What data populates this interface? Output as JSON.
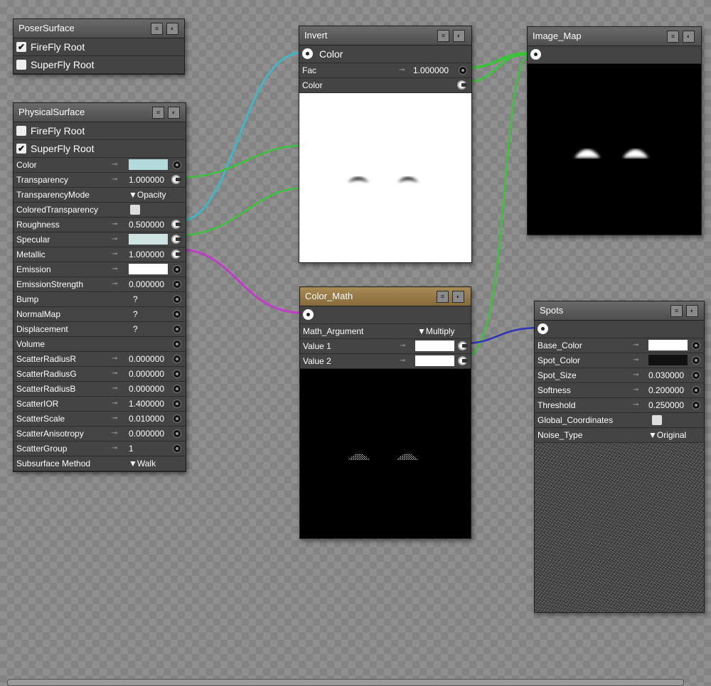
{
  "colors": {
    "wire_cyan": "#3fb7c7",
    "wire_green": "#3cc33c",
    "wire_magenta": "#c23ac9",
    "wire_blue": "#2d33b8",
    "gold_header": "#a88a55"
  },
  "poser_surface": {
    "title": "PoserSurface",
    "rows": [
      {
        "label": "FireFly Root",
        "checked": true
      },
      {
        "label": "SuperFly Root",
        "checked": false
      }
    ]
  },
  "physical_surface": {
    "title": "PhysicalSurface",
    "firefly": "FireFly Root",
    "superfly": "SuperFly Root",
    "params": [
      {
        "label": "Color"
      },
      {
        "label": "Transparency",
        "value": "1.000000"
      },
      {
        "label": "TransparencyMode",
        "value": "▼Opacity"
      },
      {
        "label": "ColoredTransparency"
      },
      {
        "label": "Roughness",
        "value": "0.500000"
      },
      {
        "label": "Specular"
      },
      {
        "label": "Metallic",
        "value": "1.000000"
      },
      {
        "label": "Emission"
      },
      {
        "label": "EmissionStrength",
        "value": "0.000000"
      },
      {
        "label": "Bump",
        "value": "?"
      },
      {
        "label": "NormalMap",
        "value": "?"
      },
      {
        "label": "Displacement",
        "value": "?"
      },
      {
        "label": "Volume"
      },
      {
        "label": "ScatterRadiusR",
        "value": "0.000000"
      },
      {
        "label": "ScatterRadiusG",
        "value": "0.000000"
      },
      {
        "label": "ScatterRadiusB",
        "value": "0.000000"
      },
      {
        "label": "ScatterIOR",
        "value": "1.400000"
      },
      {
        "label": "ScatterScale",
        "value": "0.010000"
      },
      {
        "label": "ScatterAnisotropy",
        "value": "0.000000"
      },
      {
        "label": "ScatterGroup",
        "value": "1"
      },
      {
        "label": "Subsurface Method",
        "value": "▼Walk"
      }
    ]
  },
  "invert": {
    "title": "Invert",
    "out_label": "Color",
    "fac_label": "Fac",
    "fac_value": "1.000000",
    "color_label": "Color"
  },
  "image_map": {
    "title": "Image_Map"
  },
  "color_math": {
    "title": "Color_Math",
    "arg_label": "Math_Argument",
    "arg_value": "▼Multiply",
    "v1": "Value 1",
    "v2": "Value 2"
  },
  "spots": {
    "title": "Spots",
    "params": [
      {
        "label": "Base_Color"
      },
      {
        "label": "Spot_Color"
      },
      {
        "label": "Spot_Size",
        "value": "0.030000"
      },
      {
        "label": "Softness",
        "value": "0.200000"
      },
      {
        "label": "Threshold",
        "value": "0.250000"
      },
      {
        "label": "Global_Coordinates"
      },
      {
        "label": "Noise_Type",
        "value": "▼Original"
      }
    ]
  }
}
